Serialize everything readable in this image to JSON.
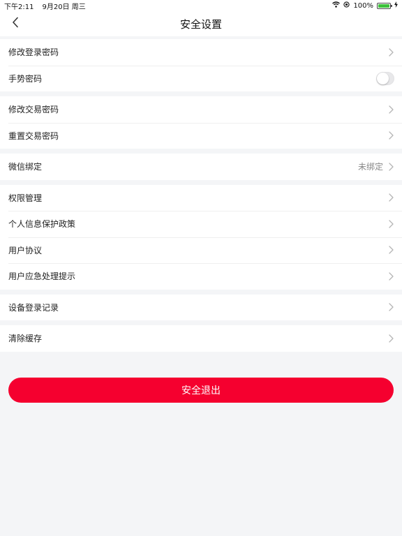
{
  "status_bar": {
    "time": "下午2:11",
    "date": "9月20日 周三",
    "battery_percent": "100%",
    "battery_level": 1.0
  },
  "nav": {
    "title": "安全设置",
    "back_icon": "chevron-left-icon"
  },
  "groups": [
    {
      "rows": [
        {
          "label": "修改登录密码",
          "type": "link"
        },
        {
          "label": "手势密码",
          "type": "toggle",
          "on": false
        }
      ]
    },
    {
      "rows": [
        {
          "label": "修改交易密码",
          "type": "link"
        },
        {
          "label": "重置交易密码",
          "type": "link"
        }
      ]
    },
    {
      "rows": [
        {
          "label": "微信绑定",
          "type": "link",
          "value": "未绑定"
        }
      ]
    },
    {
      "rows": [
        {
          "label": "权限管理",
          "type": "link"
        },
        {
          "label": "个人信息保护政策",
          "type": "link"
        },
        {
          "label": "用户协议",
          "type": "link"
        },
        {
          "label": "用户应急处理提示",
          "type": "link"
        }
      ]
    },
    {
      "rows": [
        {
          "label": "设备登录记录",
          "type": "link"
        }
      ]
    },
    {
      "rows": [
        {
          "label": "清除缓存",
          "type": "link"
        }
      ]
    }
  ],
  "logout": {
    "label": "安全退出"
  },
  "colors": {
    "accent": "#f5002f",
    "background": "#f4f5f7",
    "battery": "#3cc13b"
  }
}
